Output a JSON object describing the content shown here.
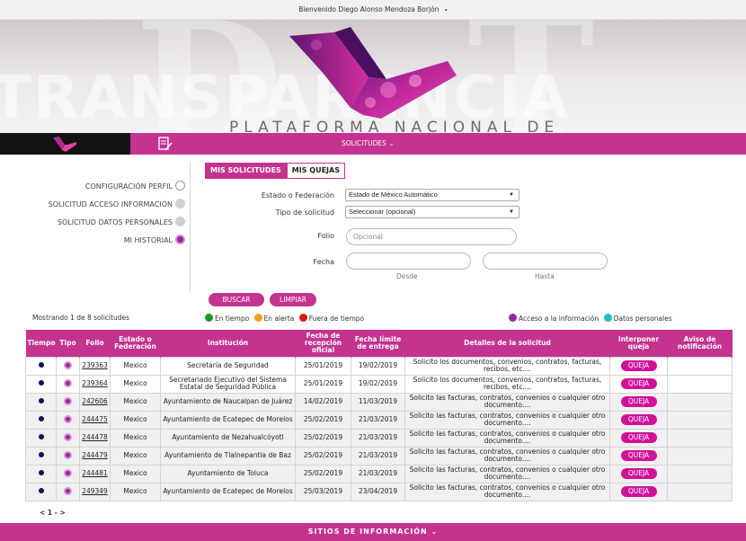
{
  "topbar": {
    "welcome": "Bienvenido Diego Alonso Mendoza Borjón",
    "caret": "▾"
  },
  "banner": {
    "bg_word": "TRANSPARENCIA",
    "platform_text": "PLATAFORMA NACIONAL DE"
  },
  "nav": {
    "solicitudes_label": "SOLICITUDES ⌄"
  },
  "sidebar": {
    "items": [
      {
        "label": "CONFIGURACIÓN PERFIL"
      },
      {
        "label": "SOLICITUD ACCESO INFORMACIÓN"
      },
      {
        "label": "SOLICITUD DATOS PERSONALES"
      },
      {
        "label": "MI HISTORIAL"
      }
    ]
  },
  "tabs": {
    "mis_solicitudes": "MIS SOLICITUDES",
    "mis_quejas": "MIS QUEJAS"
  },
  "form": {
    "estado_label": "Estado o Federación",
    "estado_value": "Estado de México Automático",
    "tipo_label": "Tipo de solicitud",
    "tipo_value": "Seleccionar (opcional)",
    "folio_label": "Folio",
    "folio_placeholder": "Opcional",
    "fecha_label": "Fecha",
    "desde": "Desde",
    "hasta": "Hasta",
    "buscar": "BUSCAR",
    "limpiar": "LIMPIAR"
  },
  "results": {
    "showing": "Mostrando 1 de 8 solicitudes"
  },
  "legend": {
    "en_tiempo": "En tiempo",
    "en_alerta": "En alerta",
    "fuera_de_tiempo": "Fuera de tiempo",
    "acceso": "Acceso a la información",
    "datos": "Datos personales",
    "colors": {
      "en_tiempo": "#1a9a2a",
      "en_alerta": "#f5a21b",
      "fuera_de_tiempo": "#e01616",
      "acceso": "#8a2d9a",
      "datos": "#2bb7d1"
    }
  },
  "table": {
    "headers": [
      "Tiempo",
      "Tipo",
      "Folio",
      "Estado o Federación",
      "Institución",
      "Fecha de recepción oficial",
      "Fecha límite de entrega",
      "Detalles de la solicitud",
      "Interponer queja",
      "Aviso de notificación"
    ],
    "queja_label": "QUEJA",
    "rows": [
      {
        "folio": "239363",
        "estado": "Mexico",
        "institucion": "Secretaría de Seguridad",
        "recepcion": "25/01/2019",
        "limite": "19/02/2019",
        "detalles": "Solicito los documentos, convenios, contratos, facturas, recibos, etc...."
      },
      {
        "folio": "239364",
        "estado": "Mexico",
        "institucion": "Secretariado Ejecutivo del Sistema Estatal de Seguridad Pública",
        "recepcion": "25/01/2019",
        "limite": "19/02/2019",
        "detalles": "Solicito los documentos, convenios, contratos, facturas, recibos, etc...."
      },
      {
        "folio": "242606",
        "estado": "Mexico",
        "institucion": "Ayuntamiento de Naucalpan de Juárez",
        "recepcion": "14/02/2019",
        "limite": "11/03/2019",
        "detalles": "Solicito las facturas, contratos, convenios o cualquier otro documento...."
      },
      {
        "folio": "244475",
        "estado": "Mexico",
        "institucion": "Ayuntamiento de Ecatepec de Morelos",
        "recepcion": "25/02/2019",
        "limite": "21/03/2019",
        "detalles": "Solicito las facturas, contratos, convenios o cualquier otro documento...."
      },
      {
        "folio": "244478",
        "estado": "Mexico",
        "institucion": "Ayuntamiento de Nezahualcóyotl",
        "recepcion": "25/02/2019",
        "limite": "21/03/2019",
        "detalles": "Solicito las facturas, contratos, convenios o cualquier otro documento...."
      },
      {
        "folio": "244479",
        "estado": "Mexico",
        "institucion": "Ayuntamiento de Tlalnepantla de Baz",
        "recepcion": "25/02/2019",
        "limite": "21/03/2019",
        "detalles": "Solicito las facturas, contratos, convenios o cualquier otro documento...."
      },
      {
        "folio": "244481",
        "estado": "Mexico",
        "institucion": "Ayuntamiento de Toluca",
        "recepcion": "25/02/2019",
        "limite": "21/03/2019",
        "detalles": "Solicito las facturas, contratos, convenios o cualquier otro documento...."
      },
      {
        "folio": "249349",
        "estado": "Mexico",
        "institucion": "Ayuntamiento de Ecatepec de Morelos",
        "recepcion": "25/03/2019",
        "limite": "23/04/2019",
        "detalles": "Solicito las facturas, contratos, convenios o cualquier otro documento...."
      }
    ]
  },
  "pager": {
    "text": "< 1 - >"
  },
  "footer": {
    "label": "SITIOS DE INFORMACIÓN ⌄"
  }
}
